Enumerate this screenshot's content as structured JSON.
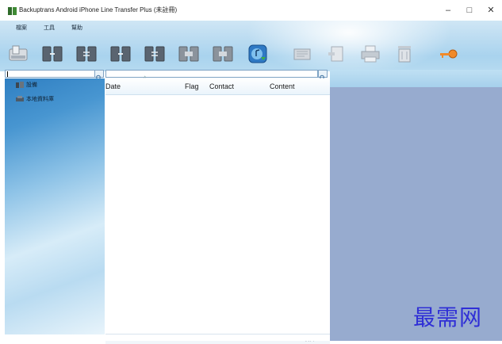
{
  "window": {
    "title": "Backuptrans Android iPhone Line Transfer Plus (未註冊)",
    "minimize_glyph": "–",
    "maximize_glyph": "□",
    "close_glyph": "✕"
  },
  "menu": {
    "items": [
      "檔案",
      "工具",
      "幫助"
    ]
  },
  "toolbar": {
    "buttons": [
      "phone-backup-icon",
      "android-to-iphone-icon",
      "iphone-to-android-icon",
      "android-to-android-icon",
      "iphone-to-iphone-icon",
      "restore-android-icon",
      "restore-iphone-icon",
      "itunes-icon",
      "export-icon",
      "import-icon",
      "print-icon",
      "delete-icon",
      "register-key-icon"
    ]
  },
  "tree": {
    "items": [
      {
        "label": "設備",
        "icon": "devices-icon"
      },
      {
        "label": "本地資料庫",
        "icon": "local-database-icon"
      }
    ]
  },
  "list": {
    "columns": [
      "Date",
      "Flag",
      "Contact",
      "Content"
    ],
    "status": "項目：0"
  },
  "watermark": "最需网",
  "colors": {
    "right_pane": "#97abcf",
    "toolbar_bg": "#bcdcf1",
    "watermark": "#2f2fd6"
  }
}
